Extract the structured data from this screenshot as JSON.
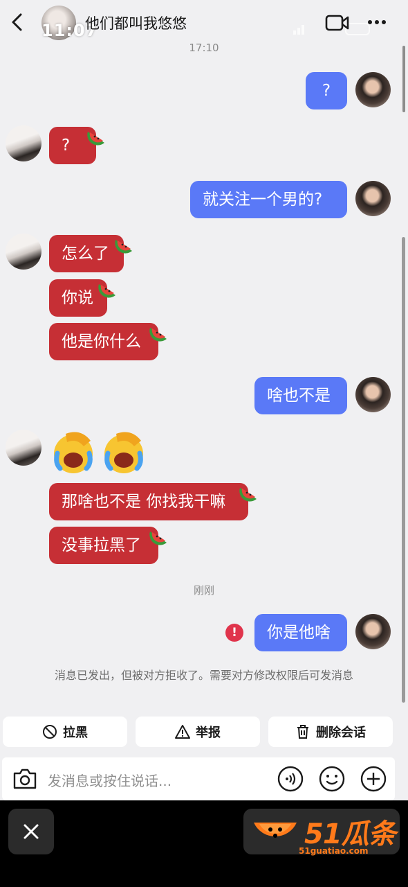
{
  "header": {
    "title": "他们都叫我悠悠",
    "status_time": "11:07"
  },
  "messages": {
    "ts1": "17:10",
    "m1": "?",
    "m2": "?",
    "m3": "就关注一个男的?",
    "m4": "怎么了",
    "m5": "你说",
    "m6": "他是你什么",
    "m7": "啥也不是",
    "m8": "那啥也不是 你找我干嘛",
    "m9": "没事拉黑了",
    "ts2": "刚刚",
    "m10": "你是他啥",
    "error_mark": "!"
  },
  "notice": "消息已发出，但被对方拒收了。需要对方修改权限后可发消息",
  "actions": {
    "block": "拉黑",
    "report": "举报",
    "delete": "删除会话"
  },
  "input": {
    "placeholder": "发消息或按住说话..."
  },
  "watermark": {
    "brand": "51瓜条",
    "url": "51guatiao.com"
  },
  "colors": {
    "sent_bubble": "#5a79f7",
    "received_bubble": "#c62f35",
    "error": "#e0344c",
    "watermark": "#ff7a1a"
  }
}
